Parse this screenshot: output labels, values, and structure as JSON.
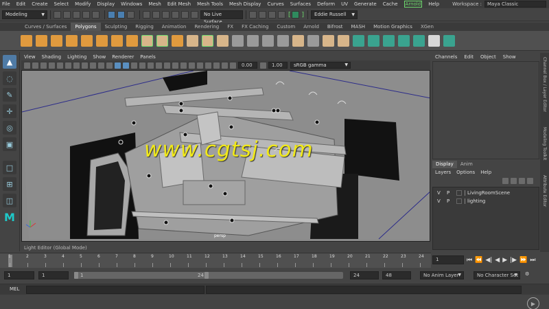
{
  "menubar": {
    "items": [
      "File",
      "Edit",
      "Create",
      "Select",
      "Modify",
      "Display",
      "Windows",
      "Mesh",
      "Edit Mesh",
      "Mesh Tools",
      "Mesh Display",
      "Curves",
      "Surfaces",
      "Deform",
      "UV",
      "Generate",
      "Cache"
    ],
    "arnold": "Arnold",
    "help": "Help",
    "workspace_label": "Workspace :",
    "workspace_value": "Maya Classic"
  },
  "statusline": {
    "mode": "Modeling",
    "live_surface": "No Live Surface",
    "user": "Eddie Russell"
  },
  "shelf": {
    "tabs": [
      "Curves / Surfaces",
      "Polygons",
      "Sculpting",
      "Rigging",
      "Animation",
      "Rendering",
      "FX",
      "FX Caching",
      "Custom",
      "Arnold",
      "Bifrost",
      "MASH",
      "Motion Graphics",
      "XGen"
    ],
    "active_tab": "Polygons"
  },
  "viewport": {
    "menus": [
      "View",
      "Shading",
      "Lighting",
      "Show",
      "Renderer",
      "Panels"
    ],
    "field_a": "0.00",
    "field_b": "1.00",
    "color_space": "sRGB gamma",
    "camera": "persp",
    "watermark": "www.cgtsj.com"
  },
  "channelbox": {
    "menus": [
      "Channels",
      "Edit",
      "Object",
      "Show"
    ],
    "side_tabs": [
      "Channel Box / Layer Editor",
      "Modeling Toolkit",
      "Attribute Editor"
    ]
  },
  "layereditor": {
    "tabs": [
      "Display",
      "Anim"
    ],
    "active_tab": "Display",
    "menus": [
      "Layers",
      "Options",
      "Help"
    ],
    "layers": [
      {
        "v": "V",
        "p": "P",
        "name": "LivingRoomScene"
      },
      {
        "v": "V",
        "p": "P",
        "name": "lighting"
      }
    ]
  },
  "lighteditor": "Light Editor (Global Mode)",
  "timeline": {
    "ticks": [
      "1",
      "2",
      "3",
      "4",
      "5",
      "6",
      "7",
      "8",
      "9",
      "10",
      "11",
      "12",
      "13",
      "14",
      "15",
      "16",
      "17",
      "18",
      "19",
      "20",
      "21",
      "22",
      "23",
      "24"
    ],
    "current_frame": "1"
  },
  "range": {
    "start": "1",
    "playback_start": "1",
    "range_start": "1",
    "range_end": "24",
    "playback_end": "24",
    "end": "48",
    "anim_layer": "No Anim Layer",
    "char_set": "No Character Set"
  },
  "mel": {
    "label": "MEL"
  },
  "colors": {
    "accent_green": "#6fdc6f",
    "active_blue": "#4f7ba6",
    "watermark": "#f0e81a"
  }
}
